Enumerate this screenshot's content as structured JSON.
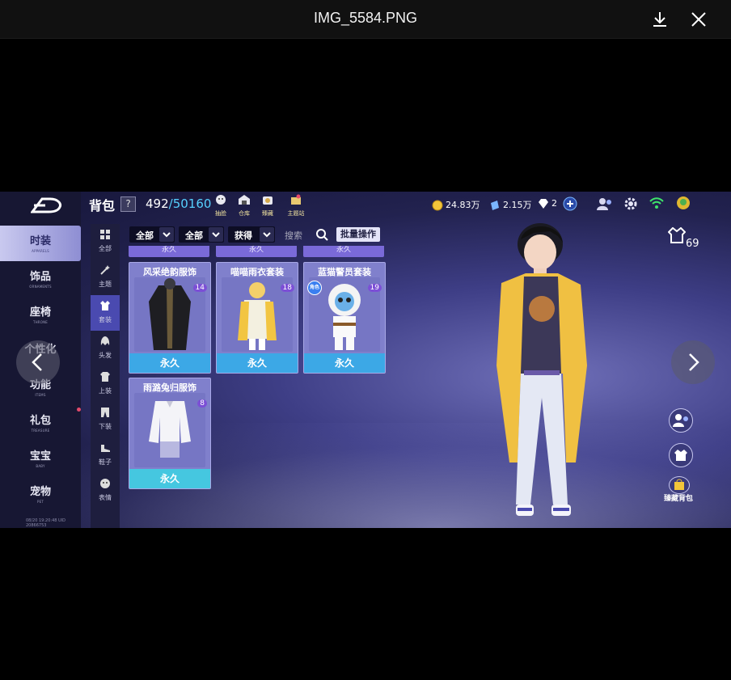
{
  "viewer": {
    "title": "IMG_5584.PNG",
    "download_icon": "download-icon",
    "close_icon": "close-icon"
  },
  "game": {
    "header": {
      "title": "背包",
      "help": "?",
      "capacity_used": "492",
      "capacity_max": "/50160",
      "icons": [
        {
          "label": "抽脸",
          "icon": "face-gift-icon"
        },
        {
          "label": "仓库",
          "icon": "warehouse-icon"
        },
        {
          "label": "臻藏",
          "icon": "collection-icon"
        },
        {
          "label": "主题站",
          "icon": "theme-station-icon"
        }
      ],
      "gold": "24.83万",
      "coupon": "2.15万",
      "diamond": "2"
    },
    "sidebar": [
      {
        "cn": "时装",
        "en": "APPARELS",
        "active": true
      },
      {
        "cn": "饰品",
        "en": "ORNAMENTS"
      },
      {
        "cn": "座椅",
        "en": "THRONE"
      },
      {
        "cn": "个性化",
        "en": ""
      },
      {
        "cn": "功能",
        "en": "ITEMS"
      },
      {
        "cn": "礼包",
        "en": "TREASURE"
      },
      {
        "cn": "宝宝",
        "en": "BABY"
      },
      {
        "cn": "宠物",
        "en": "PET"
      }
    ],
    "subcategories": [
      {
        "label": "全部"
      },
      {
        "label": "主题"
      },
      {
        "label": "套装",
        "active": true
      },
      {
        "label": "头发"
      },
      {
        "label": "上装"
      },
      {
        "label": "下装"
      },
      {
        "label": "鞋子"
      },
      {
        "label": "表情"
      }
    ],
    "filters": {
      "f1": "全部",
      "f2": "全部",
      "f3": "获得",
      "search_label": "搜索",
      "batch": "批量操作"
    },
    "stub_text": "永久",
    "cards": [
      {
        "name": "风采绝韵服饰",
        "level": "14",
        "status": "永久"
      },
      {
        "name": "喵喵雨衣套装",
        "level": "18",
        "status": "永久"
      },
      {
        "name": "蓝猫警员套装",
        "level": "19",
        "status": "永久",
        "badge": "角色"
      },
      {
        "name": "雨潞兔归服饰",
        "level": "8",
        "status": "永久"
      }
    ],
    "outfit_count": "69",
    "bottom_button": "臻藏背包",
    "timestamp": "08/20 19:20:48 UID 20866753"
  },
  "colors": {
    "accent_blue": "#56d0ff",
    "permanent_bar": "#3ca8e6",
    "level_badge": "#7c4fd6"
  }
}
